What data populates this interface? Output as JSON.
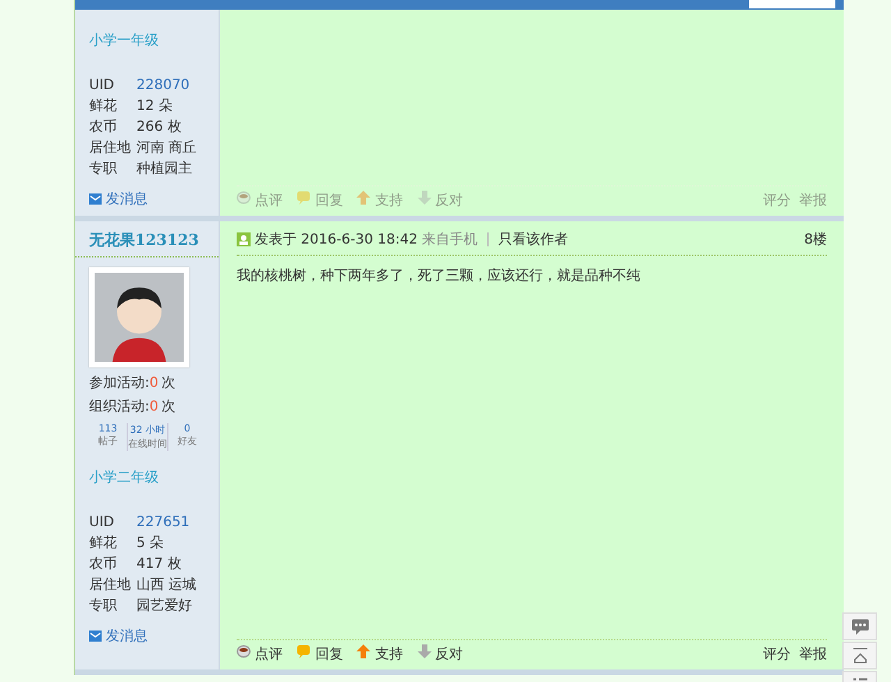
{
  "posts": [
    {
      "dimmed": true,
      "rank": "小学一年级",
      "profile": [
        {
          "label": "UID",
          "value": "228070",
          "kind": "link"
        },
        {
          "label": "鲜花",
          "value": "12 朵",
          "kind": "text"
        },
        {
          "label": "农币",
          "value": "266 枚",
          "kind": "text"
        },
        {
          "label": "居住地",
          "value": "河南 商丘",
          "kind": "text"
        },
        {
          "label": "专职",
          "value": "种植园主",
          "kind": "text"
        }
      ],
      "message_link": "发消息",
      "actions": [
        {
          "kind": "comment",
          "label": "点评"
        },
        {
          "kind": "reply",
          "label": "回复"
        },
        {
          "kind": "support",
          "label": "支持"
        },
        {
          "kind": "oppose",
          "label": "反对"
        }
      ],
      "right_actions": [
        "评分",
        "举报"
      ]
    },
    {
      "dimmed": false,
      "author": "无花果123123",
      "activity": [
        {
          "label": "参加活动:",
          "count": "0",
          "unit": "次"
        },
        {
          "label": "组织活动:",
          "count": "0",
          "unit": "次"
        }
      ],
      "stats": [
        {
          "value": "113",
          "label": "帖子"
        },
        {
          "value": "32 小时",
          "label": "在线时间"
        },
        {
          "value": "0",
          "label": "好友"
        }
      ],
      "rank": "小学二年级",
      "profile": [
        {
          "label": "UID",
          "value": "227651",
          "kind": "link"
        },
        {
          "label": "鲜花",
          "value": "5 朵",
          "kind": "text"
        },
        {
          "label": "农币",
          "value": "417 枚",
          "kind": "text"
        },
        {
          "label": "居住地",
          "value": "山西 运城",
          "kind": "text"
        },
        {
          "label": "专职",
          "value": "园艺爱好",
          "kind": "text"
        }
      ],
      "message_link": "发消息",
      "meta": {
        "posted": "发表于 2016-6-30 18:42",
        "source": "来自手机",
        "author_only": "只看该作者",
        "floor": "8楼"
      },
      "body": "我的核桃树，种下两年多了，死了三颗，应该还行，就是品种不纯",
      "actions": [
        {
          "kind": "comment",
          "label": "点评"
        },
        {
          "kind": "reply",
          "label": "回复"
        },
        {
          "kind": "support",
          "label": "支持"
        },
        {
          "kind": "oppose",
          "label": "反对"
        }
      ],
      "right_actions": [
        "评分",
        "举报"
      ]
    }
  ]
}
